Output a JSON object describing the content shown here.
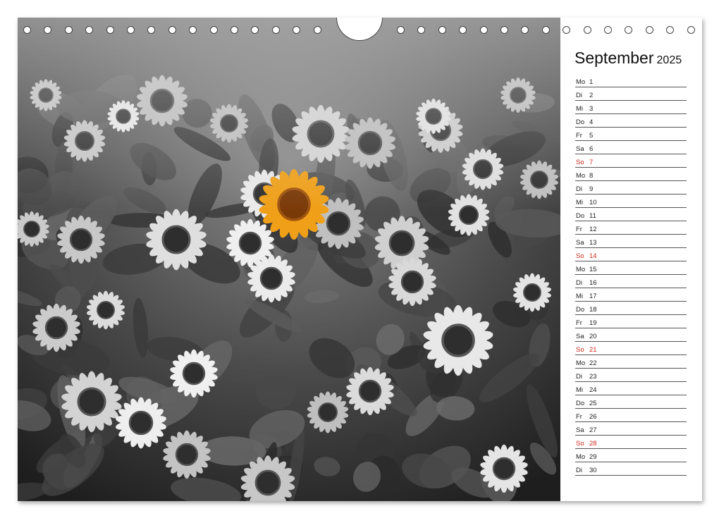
{
  "month": {
    "name": "September",
    "year": "2025"
  },
  "days": [
    {
      "wd": "Mo",
      "d": "1",
      "sun": false
    },
    {
      "wd": "Di",
      "d": "2",
      "sun": false
    },
    {
      "wd": "Mi",
      "d": "3",
      "sun": false
    },
    {
      "wd": "Do",
      "d": "4",
      "sun": false
    },
    {
      "wd": "Fr",
      "d": "5",
      "sun": false
    },
    {
      "wd": "Sa",
      "d": "6",
      "sun": false
    },
    {
      "wd": "So",
      "d": "7",
      "sun": true
    },
    {
      "wd": "Mo",
      "d": "8",
      "sun": false
    },
    {
      "wd": "Di",
      "d": "9",
      "sun": false
    },
    {
      "wd": "Mi",
      "d": "10",
      "sun": false
    },
    {
      "wd": "Do",
      "d": "11",
      "sun": false
    },
    {
      "wd": "Fr",
      "d": "12",
      "sun": false
    },
    {
      "wd": "Sa",
      "d": "13",
      "sun": false
    },
    {
      "wd": "So",
      "d": "14",
      "sun": true
    },
    {
      "wd": "Mo",
      "d": "15",
      "sun": false
    },
    {
      "wd": "Di",
      "d": "16",
      "sun": false
    },
    {
      "wd": "Mi",
      "d": "17",
      "sun": false
    },
    {
      "wd": "Do",
      "d": "18",
      "sun": false
    },
    {
      "wd": "Fr",
      "d": "19",
      "sun": false
    },
    {
      "wd": "Sa",
      "d": "20",
      "sun": false
    },
    {
      "wd": "So",
      "d": "21",
      "sun": true
    },
    {
      "wd": "Mo",
      "d": "22",
      "sun": false
    },
    {
      "wd": "Di",
      "d": "23",
      "sun": false
    },
    {
      "wd": "Mi",
      "d": "24",
      "sun": false
    },
    {
      "wd": "Do",
      "d": "25",
      "sun": false
    },
    {
      "wd": "Fr",
      "d": "26",
      "sun": false
    },
    {
      "wd": "Sa",
      "d": "27",
      "sun": false
    },
    {
      "wd": "So",
      "d": "28",
      "sun": true
    },
    {
      "wd": "Mo",
      "d": "29",
      "sun": false
    },
    {
      "wd": "Di",
      "d": "30",
      "sun": false
    }
  ],
  "photo": {
    "subject": "sunflower-field-icon",
    "highlight_color": "#f0a018"
  },
  "colors": {
    "sunday": "#cc2a1e",
    "text": "#222222"
  }
}
